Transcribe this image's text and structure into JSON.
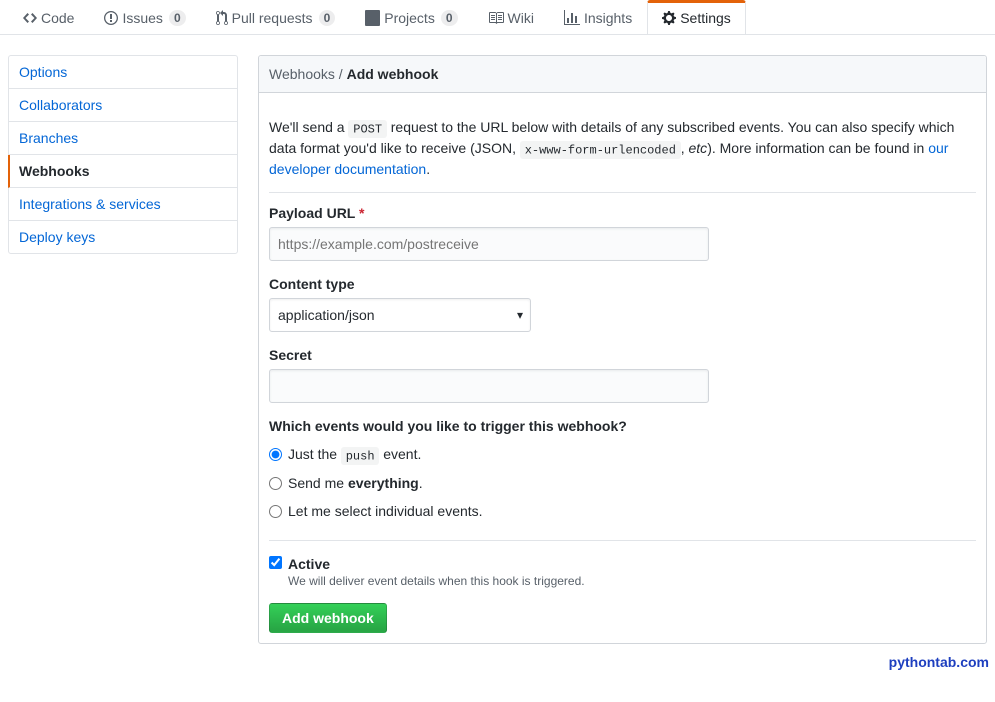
{
  "tabs": {
    "code": "Code",
    "issues": "Issues",
    "issues_count": "0",
    "pulls": "Pull requests",
    "pulls_count": "0",
    "projects": "Projects",
    "projects_count": "0",
    "wiki": "Wiki",
    "insights": "Insights",
    "settings": "Settings"
  },
  "sidebar": {
    "options": "Options",
    "collaborators": "Collaborators",
    "branches": "Branches",
    "webhooks": "Webhooks",
    "integrations": "Integrations & services",
    "deploy_keys": "Deploy keys"
  },
  "breadcrumb": {
    "parent": "Webhooks",
    "sep": " / ",
    "current": "Add webhook"
  },
  "intro": {
    "t1": "We'll send a ",
    "code1": "POST",
    "t2": " request to the URL below with details of any subscribed events. You can also specify which data format you'd like to receive (JSON, ",
    "code2": "x-www-form-urlencoded",
    "t3": ", ",
    "em": "etc",
    "t4": "). More information can be found in ",
    "link": "our developer documentation",
    "t5": "."
  },
  "form": {
    "payload_label": "Payload URL",
    "payload_placeholder": "https://example.com/postreceive",
    "content_type_label": "Content type",
    "content_type_value": "application/json",
    "secret_label": "Secret",
    "events_question": "Which events would you like to trigger this webhook?",
    "opt_push_a": "Just the ",
    "opt_push_code": "push",
    "opt_push_b": " event.",
    "opt_everything_a": "Send me ",
    "opt_everything_b": "everything",
    "opt_everything_c": ".",
    "opt_individual": "Let me select individual events.",
    "active_label": "Active",
    "active_note": "We will deliver event details when this hook is triggered.",
    "submit": "Add webhook"
  },
  "watermark": "pythontab.com"
}
